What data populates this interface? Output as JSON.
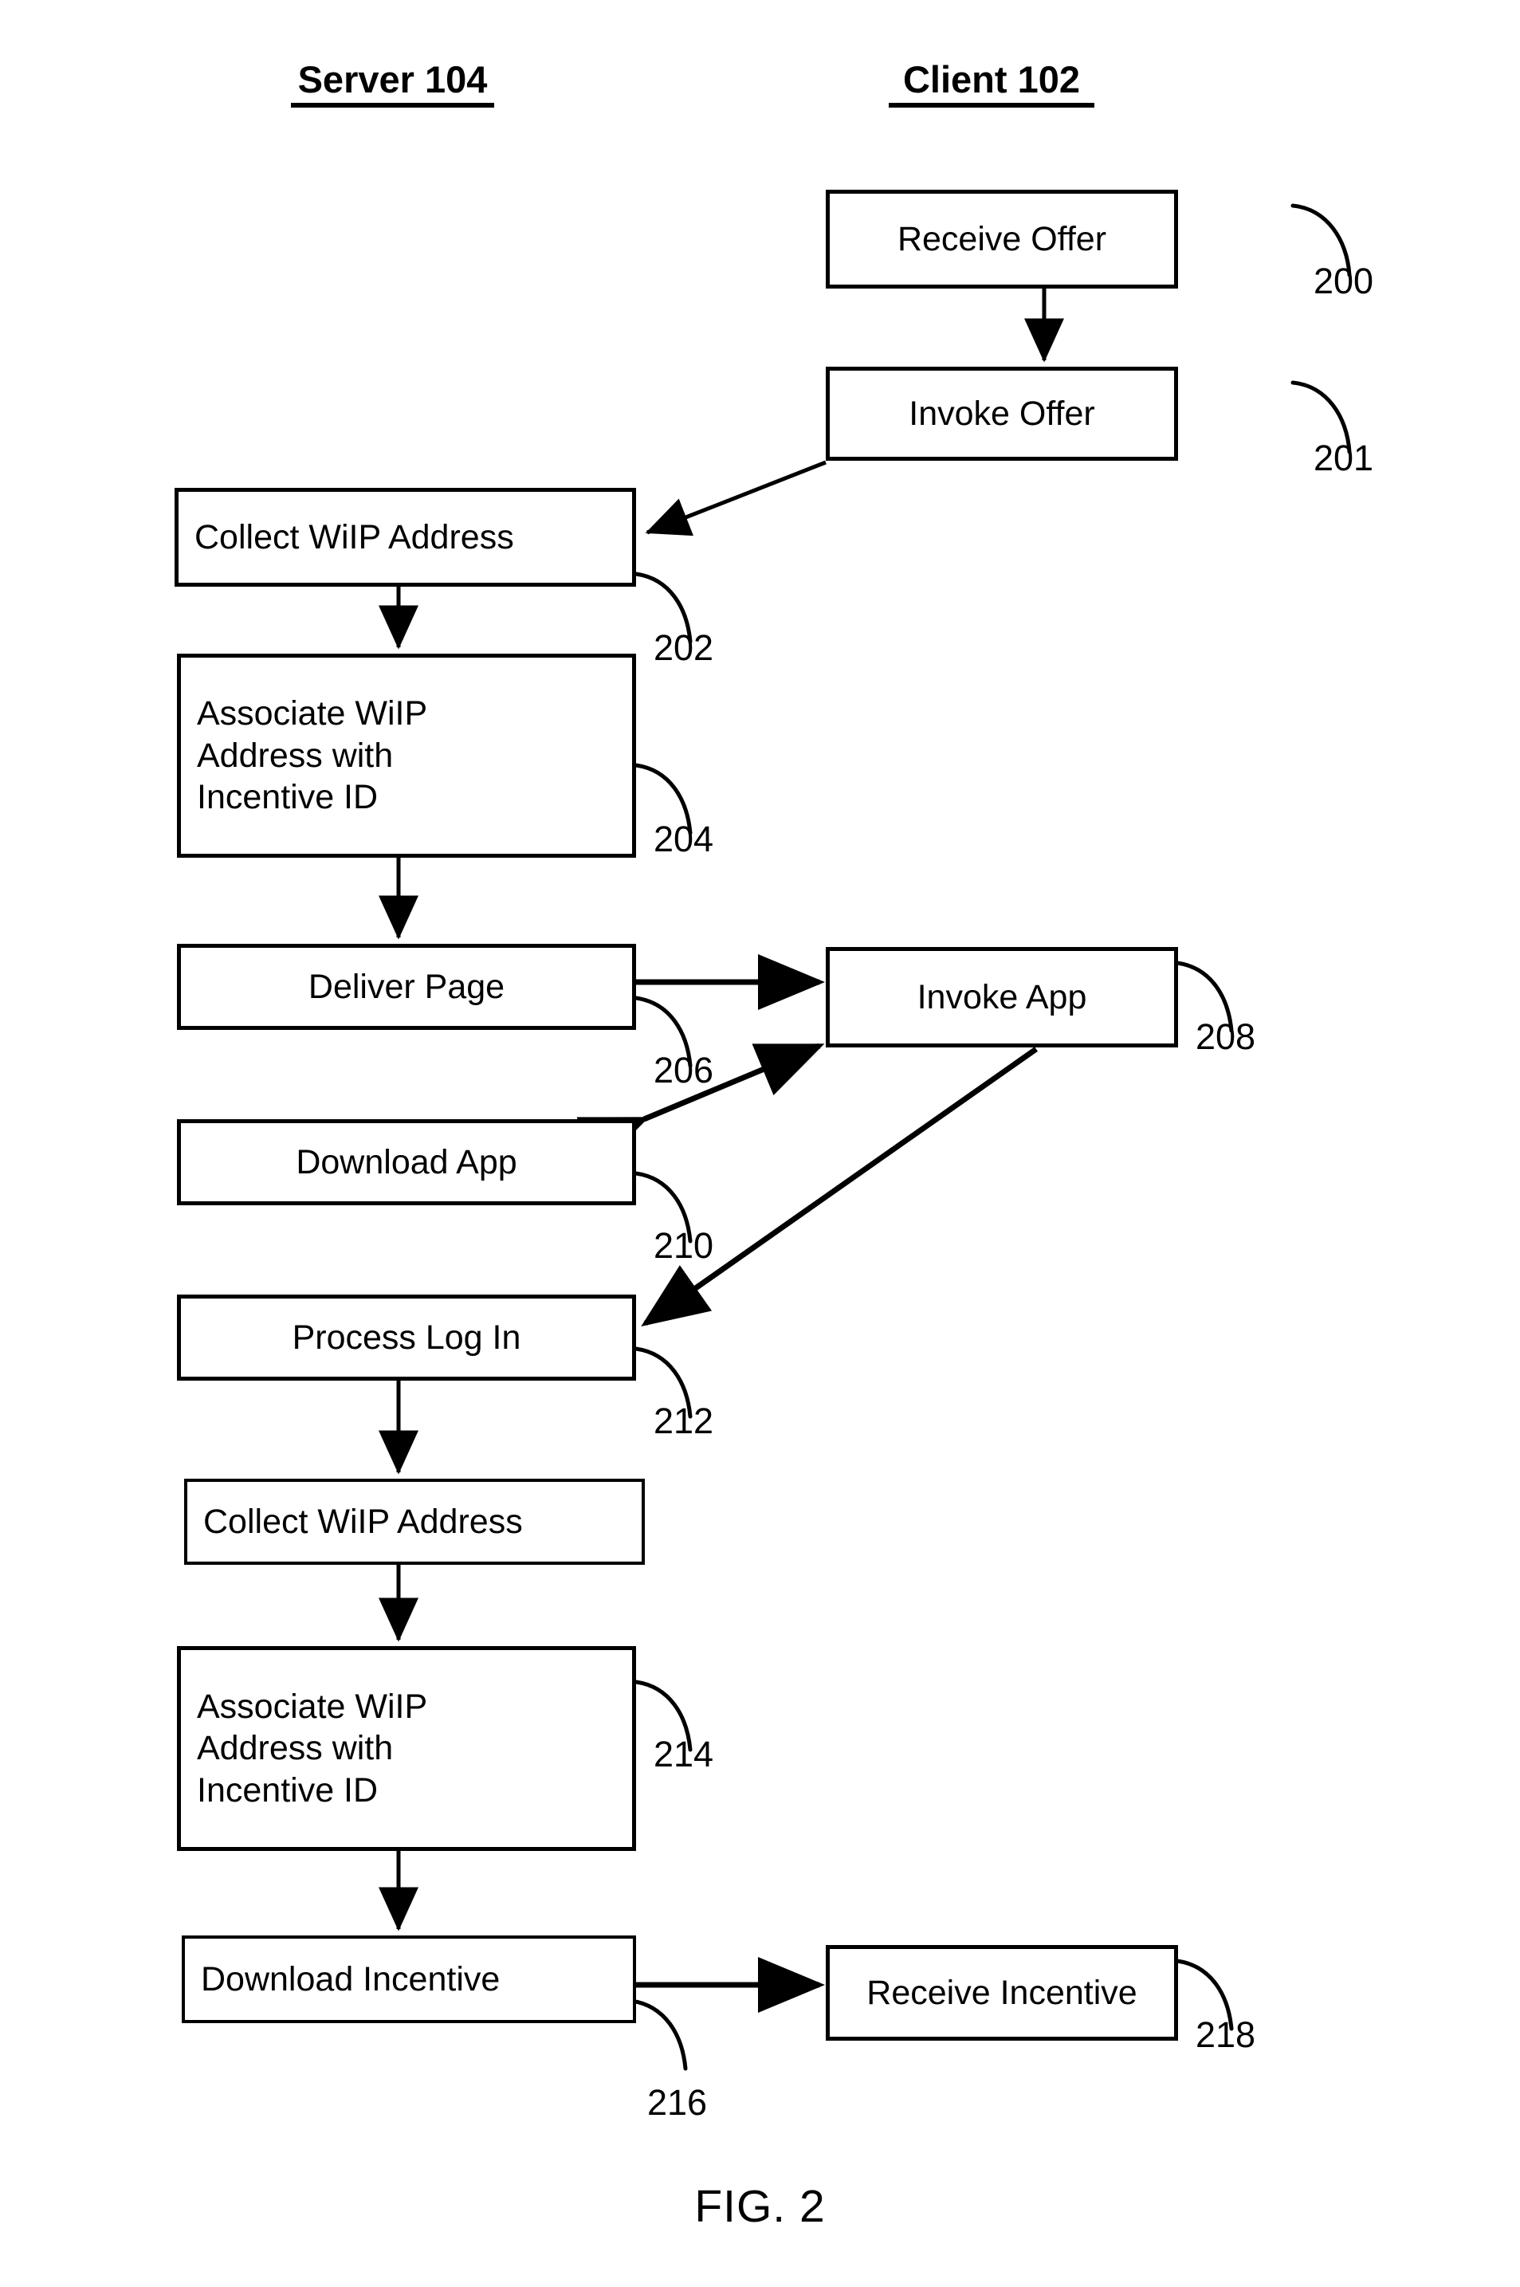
{
  "figure": {
    "caption": "FIG. 2",
    "columns": [
      {
        "id": "server",
        "label": "Server 104"
      },
      {
        "id": "client",
        "label": "Client 102"
      }
    ]
  },
  "nodes": [
    {
      "id": "n200",
      "label": "Receive Offer",
      "ref": "200",
      "column": "client"
    },
    {
      "id": "n201",
      "label": "Invoke Offer",
      "ref": "201",
      "column": "client"
    },
    {
      "id": "n202",
      "label": "Collect WiIP Address",
      "ref": "202",
      "column": "server"
    },
    {
      "id": "n204",
      "label": "Associate WiIP\nAddress with\nIncentive ID",
      "ref": "204",
      "column": "server"
    },
    {
      "id": "n206",
      "label": "Deliver Page",
      "ref": "206",
      "column": "server"
    },
    {
      "id": "n208",
      "label": "Invoke App",
      "ref": "208",
      "column": "client"
    },
    {
      "id": "n210",
      "label": "Download App",
      "ref": "210",
      "column": "server"
    },
    {
      "id": "n212",
      "label": "Process Log In",
      "ref": "212",
      "column": "server"
    },
    {
      "id": "n213",
      "label": "Collect WiIP Address",
      "ref": "",
      "column": "server"
    },
    {
      "id": "n214",
      "label": "Associate WiIP\nAddress with\nIncentive ID",
      "ref": "214",
      "column": "server"
    },
    {
      "id": "n216",
      "label": "Download Incentive",
      "ref": "216",
      "column": "server"
    },
    {
      "id": "n218",
      "label": "Receive Incentive",
      "ref": "218",
      "column": "client"
    }
  ],
  "refs": {
    "r200": "200",
    "r201": "201",
    "r202": "202",
    "r204": "204",
    "r206": "206",
    "r208": "208",
    "r210": "210",
    "r212": "212",
    "r214": "214",
    "r216": "216",
    "r218": "218"
  },
  "edges": [
    {
      "id": "e1",
      "from": "n200",
      "to": "n201",
      "kind": "arrow",
      "direction": "down"
    },
    {
      "id": "e2",
      "from": "n201",
      "to": "n202",
      "kind": "arrow",
      "direction": "diagonal-left"
    },
    {
      "id": "e3",
      "from": "n202",
      "to": "n204",
      "kind": "arrow",
      "direction": "down"
    },
    {
      "id": "e4",
      "from": "n204",
      "to": "n206",
      "kind": "arrow",
      "direction": "down"
    },
    {
      "id": "e5",
      "from": "n206",
      "to": "n208",
      "kind": "arrow",
      "direction": "right"
    },
    {
      "id": "e6",
      "from": "n210",
      "to": "n208",
      "kind": "double-arrow",
      "direction": "diagonal"
    },
    {
      "id": "e7",
      "from": "n208",
      "to": "n212",
      "kind": "arrow",
      "direction": "diagonal-left"
    },
    {
      "id": "e8",
      "from": "n212",
      "to": "n213",
      "kind": "arrow",
      "direction": "down"
    },
    {
      "id": "e9",
      "from": "n213",
      "to": "n214",
      "kind": "arrow",
      "direction": "down"
    },
    {
      "id": "e10",
      "from": "n214",
      "to": "n216",
      "kind": "arrow",
      "direction": "down"
    },
    {
      "id": "e11",
      "from": "n216",
      "to": "n218",
      "kind": "arrow",
      "direction": "right"
    }
  ],
  "style": {
    "stroke": "#000000",
    "background": "#ffffff"
  }
}
